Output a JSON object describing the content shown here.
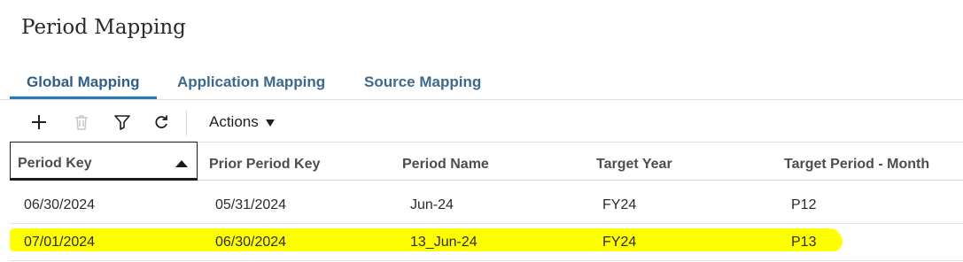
{
  "page": {
    "title": "Period Mapping"
  },
  "tabs": [
    {
      "label": "Global Mapping",
      "active": true
    },
    {
      "label": "Application Mapping",
      "active": false
    },
    {
      "label": "Source Mapping",
      "active": false
    }
  ],
  "toolbar": {
    "icons": [
      "add-icon",
      "delete-icon",
      "filter-icon",
      "refresh-icon"
    ],
    "actions_label": "Actions"
  },
  "table": {
    "columns": [
      "Period Key",
      "Prior Period Key",
      "Period Name",
      "Target Year",
      "Target Period - Month"
    ],
    "sorted_column": "Period Key",
    "sort_direction": "ascending",
    "rows": [
      [
        "06/30/2024",
        "05/31/2024",
        "Jun-24",
        "FY24",
        "P12"
      ],
      [
        "07/01/2024",
        "06/30/2024",
        "13_Jun-24",
        "FY24",
        "P13"
      ]
    ],
    "highlight_color": "#ffff00"
  }
}
